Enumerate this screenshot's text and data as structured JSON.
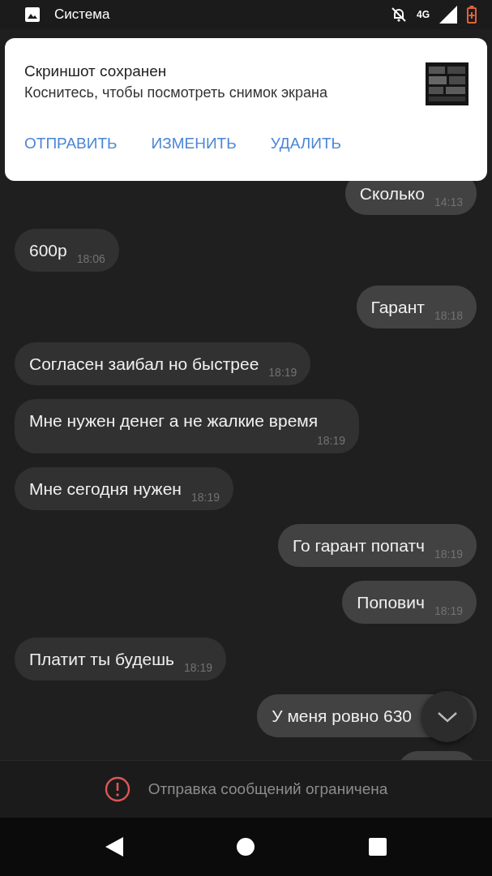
{
  "status_bar": {
    "app_name": "Система",
    "network": "4G"
  },
  "notification": {
    "title": "Скриншот сохранен",
    "body": "Коснитесь, чтобы посмотреть снимок экрана",
    "actions": [
      "ОТПРАВИТЬ",
      "ИЗМЕНИТЬ",
      "УДАЛИТЬ"
    ]
  },
  "messages": [
    {
      "outgoing": true,
      "text": "Сколько",
      "time": "14:13"
    },
    {
      "outgoing": false,
      "text": "600р",
      "time": "18:06"
    },
    {
      "outgoing": true,
      "text": "Гарант",
      "time": "18:18"
    },
    {
      "outgoing": false,
      "text": "Согласен заибал но быстрее",
      "time": "18:19"
    },
    {
      "outgoing": false,
      "text": "Мне нужен денег а не жалкие время",
      "time": "18:19"
    },
    {
      "outgoing": false,
      "text": "Мне сегодня нужен",
      "time": "18:19"
    },
    {
      "outgoing": true,
      "text": "Го гарант попатч",
      "time": "18:19"
    },
    {
      "outgoing": true,
      "text": "Попович",
      "time": "18:19"
    },
    {
      "outgoing": false,
      "text": "Платит ты будешь",
      "time": "18:19"
    },
    {
      "outgoing": true,
      "text": "У меня ровно 630"
    },
    {
      "outgoing": true
    }
  ],
  "restriction": {
    "text": "Отправка сообщений ограничена"
  }
}
